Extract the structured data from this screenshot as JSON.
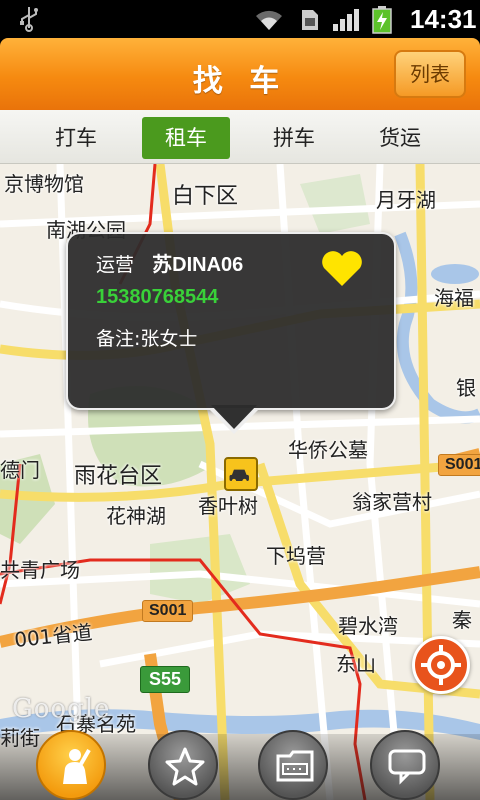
{
  "status_bar": {
    "time": "14:31",
    "icons": [
      "usb-icon",
      "wifi-icon",
      "sim-icon",
      "signal-icon",
      "battery-charging-icon"
    ]
  },
  "header": {
    "title": "找 车",
    "list_button": "列表"
  },
  "tabs": [
    {
      "label": "打车",
      "active": false
    },
    {
      "label": "租车",
      "active": true
    },
    {
      "label": "拼车",
      "active": false
    },
    {
      "label": "货运",
      "active": false
    }
  ],
  "popup": {
    "status": "运营",
    "plate": "苏DINA06",
    "phone": "15380768544",
    "note": "备注:张女士",
    "favorite_icon": "heart-icon"
  },
  "map": {
    "labels": {
      "museum": "京博物馆",
      "baixia": "白下区",
      "yueyahu": "月牙湖",
      "nanhu_park": "南湖公园",
      "haifu": "海福",
      "yin": "银",
      "huaqiao_cemetery": "华侨公墓",
      "yuhuatai": "雨花台区",
      "demen": "德门",
      "xiangyeshu": "香叶树",
      "huashenhu": "花神湖",
      "wengjiaying": "翁家营村",
      "xiawuying": "下坞营",
      "qingguangchang": "共青广场",
      "bishuiwan": "碧水湾",
      "qin": "秦",
      "dongshan": "东山",
      "shijie": "莉街",
      "shiziyuan": "石寨名苑",
      "road_001": "001省道"
    },
    "shields": {
      "s001_right": "S001",
      "s001_mid": "S001",
      "s55": "S55"
    },
    "watermark": "Google"
  },
  "bottom_nav": [
    {
      "icon": "person-icon",
      "active": true
    },
    {
      "icon": "star-icon",
      "active": false
    },
    {
      "icon": "folder-icon",
      "active": false
    },
    {
      "icon": "message-icon",
      "active": false
    }
  ],
  "colors": {
    "header_orange": "#f68a10",
    "tab_active_green": "#4b9a1e",
    "phone_green": "#39d139",
    "popup_bg": "#2c2c2c",
    "taxi_yellow": "#f7c31c",
    "locate_orange": "#e8531c"
  }
}
